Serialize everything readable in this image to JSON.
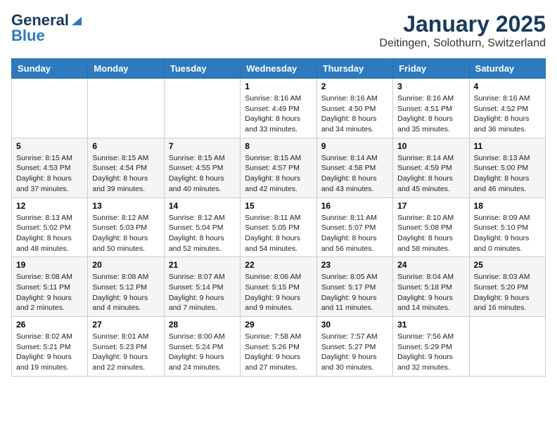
{
  "header": {
    "logo_general": "General",
    "logo_blue": "Blue",
    "month": "January 2025",
    "location": "Deitingen, Solothurn, Switzerland"
  },
  "weekdays": [
    "Sunday",
    "Monday",
    "Tuesday",
    "Wednesday",
    "Thursday",
    "Friday",
    "Saturday"
  ],
  "weeks": [
    [
      {
        "day": "",
        "info": ""
      },
      {
        "day": "",
        "info": ""
      },
      {
        "day": "",
        "info": ""
      },
      {
        "day": "1",
        "info": "Sunrise: 8:16 AM\nSunset: 4:49 PM\nDaylight: 8 hours\nand 33 minutes."
      },
      {
        "day": "2",
        "info": "Sunrise: 8:16 AM\nSunset: 4:50 PM\nDaylight: 8 hours\nand 34 minutes."
      },
      {
        "day": "3",
        "info": "Sunrise: 8:16 AM\nSunset: 4:51 PM\nDaylight: 8 hours\nand 35 minutes."
      },
      {
        "day": "4",
        "info": "Sunrise: 8:16 AM\nSunset: 4:52 PM\nDaylight: 8 hours\nand 36 minutes."
      }
    ],
    [
      {
        "day": "5",
        "info": "Sunrise: 8:15 AM\nSunset: 4:53 PM\nDaylight: 8 hours\nand 37 minutes."
      },
      {
        "day": "6",
        "info": "Sunrise: 8:15 AM\nSunset: 4:54 PM\nDaylight: 8 hours\nand 39 minutes."
      },
      {
        "day": "7",
        "info": "Sunrise: 8:15 AM\nSunset: 4:55 PM\nDaylight: 8 hours\nand 40 minutes."
      },
      {
        "day": "8",
        "info": "Sunrise: 8:15 AM\nSunset: 4:57 PM\nDaylight: 8 hours\nand 42 minutes."
      },
      {
        "day": "9",
        "info": "Sunrise: 8:14 AM\nSunset: 4:58 PM\nDaylight: 8 hours\nand 43 minutes."
      },
      {
        "day": "10",
        "info": "Sunrise: 8:14 AM\nSunset: 4:59 PM\nDaylight: 8 hours\nand 45 minutes."
      },
      {
        "day": "11",
        "info": "Sunrise: 8:13 AM\nSunset: 5:00 PM\nDaylight: 8 hours\nand 46 minutes."
      }
    ],
    [
      {
        "day": "12",
        "info": "Sunrise: 8:13 AM\nSunset: 5:02 PM\nDaylight: 8 hours\nand 48 minutes."
      },
      {
        "day": "13",
        "info": "Sunrise: 8:12 AM\nSunset: 5:03 PM\nDaylight: 8 hours\nand 50 minutes."
      },
      {
        "day": "14",
        "info": "Sunrise: 8:12 AM\nSunset: 5:04 PM\nDaylight: 8 hours\nand 52 minutes."
      },
      {
        "day": "15",
        "info": "Sunrise: 8:11 AM\nSunset: 5:05 PM\nDaylight: 8 hours\nand 54 minutes."
      },
      {
        "day": "16",
        "info": "Sunrise: 8:11 AM\nSunset: 5:07 PM\nDaylight: 8 hours\nand 56 minutes."
      },
      {
        "day": "17",
        "info": "Sunrise: 8:10 AM\nSunset: 5:08 PM\nDaylight: 8 hours\nand 58 minutes."
      },
      {
        "day": "18",
        "info": "Sunrise: 8:09 AM\nSunset: 5:10 PM\nDaylight: 9 hours\nand 0 minutes."
      }
    ],
    [
      {
        "day": "19",
        "info": "Sunrise: 8:08 AM\nSunset: 5:11 PM\nDaylight: 9 hours\nand 2 minutes."
      },
      {
        "day": "20",
        "info": "Sunrise: 8:08 AM\nSunset: 5:12 PM\nDaylight: 9 hours\nand 4 minutes."
      },
      {
        "day": "21",
        "info": "Sunrise: 8:07 AM\nSunset: 5:14 PM\nDaylight: 9 hours\nand 7 minutes."
      },
      {
        "day": "22",
        "info": "Sunrise: 8:06 AM\nSunset: 5:15 PM\nDaylight: 9 hours\nand 9 minutes."
      },
      {
        "day": "23",
        "info": "Sunrise: 8:05 AM\nSunset: 5:17 PM\nDaylight: 9 hours\nand 11 minutes."
      },
      {
        "day": "24",
        "info": "Sunrise: 8:04 AM\nSunset: 5:18 PM\nDaylight: 9 hours\nand 14 minutes."
      },
      {
        "day": "25",
        "info": "Sunrise: 8:03 AM\nSunset: 5:20 PM\nDaylight: 9 hours\nand 16 minutes."
      }
    ],
    [
      {
        "day": "26",
        "info": "Sunrise: 8:02 AM\nSunset: 5:21 PM\nDaylight: 9 hours\nand 19 minutes."
      },
      {
        "day": "27",
        "info": "Sunrise: 8:01 AM\nSunset: 5:23 PM\nDaylight: 9 hours\nand 22 minutes."
      },
      {
        "day": "28",
        "info": "Sunrise: 8:00 AM\nSunset: 5:24 PM\nDaylight: 9 hours\nand 24 minutes."
      },
      {
        "day": "29",
        "info": "Sunrise: 7:58 AM\nSunset: 5:26 PM\nDaylight: 9 hours\nand 27 minutes."
      },
      {
        "day": "30",
        "info": "Sunrise: 7:57 AM\nSunset: 5:27 PM\nDaylight: 9 hours\nand 30 minutes."
      },
      {
        "day": "31",
        "info": "Sunrise: 7:56 AM\nSunset: 5:29 PM\nDaylight: 9 hours\nand 32 minutes."
      },
      {
        "day": "",
        "info": ""
      }
    ]
  ]
}
